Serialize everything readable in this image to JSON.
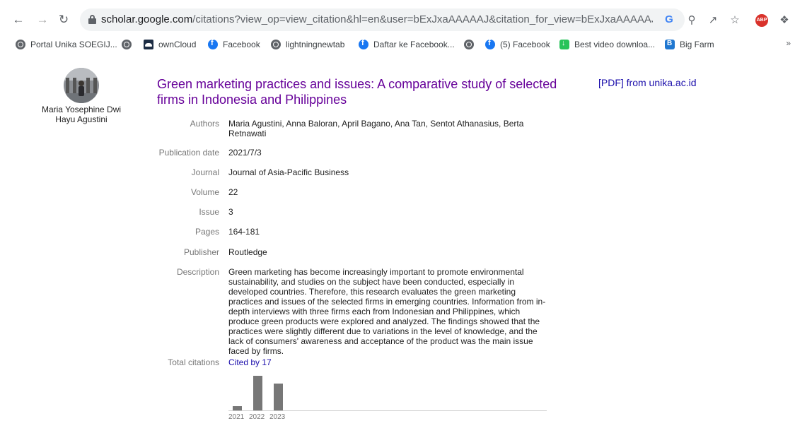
{
  "browser": {
    "url_host": "scholar.google.com",
    "url_rest": "/citations?view_op=view_citation&hl=en&user=bExJxaAAAAAJ&citation_for_view=bExJxaAAAAAJ:aqlVkmm...",
    "extension_abp": "ABP",
    "bookmarks": [
      {
        "label": "Portal Unika SOEGIJ...",
        "icon": "globe-icon"
      },
      {
        "label": "",
        "icon": "globe-icon"
      },
      {
        "label": "ownCloud",
        "icon": "owncloud-icon"
      },
      {
        "label": "Facebook",
        "icon": "facebook-icon"
      },
      {
        "label": "lightningnewtab",
        "icon": "globe-icon"
      },
      {
        "label": "Daftar ke Facebook...",
        "icon": "facebook-icon"
      },
      {
        "label": "",
        "icon": "globe-icon"
      },
      {
        "label": "(5) Facebook",
        "icon": "facebook-icon"
      },
      {
        "label": "Best video downloa...",
        "icon": "download-icon"
      },
      {
        "label": "Big Farm",
        "icon": "bigfarm-icon"
      }
    ],
    "more": "»"
  },
  "profile": {
    "name": "Maria Yosephine Dwi Hayu Agustini"
  },
  "article": {
    "title": "Green marketing practices and issues: A comparative study of selected firms in Indonesia and Philippines",
    "pdf_link": "[PDF] from unika.ac.id",
    "fields": {
      "authors_label": "Authors",
      "authors": "Maria Agustini, Anna Baloran, April Bagano, Ana Tan, Sentot Athanasius, Berta Retnawati",
      "pubdate_label": "Publication date",
      "pubdate": "2021/7/3",
      "journal_label": "Journal",
      "journal": "Journal of Asia-Pacific Business",
      "volume_label": "Volume",
      "volume": "22",
      "issue_label": "Issue",
      "issue": "3",
      "pages_label": "Pages",
      "pages": "164-181",
      "publisher_label": "Publisher",
      "publisher": "Routledge",
      "description_label": "Description",
      "description": "Green marketing has become increasingly important to promote environmental sustainability, and studies on the subject have been conducted, especially in developed countries. Therefore, this research evaluates the green marketing practices and issues of the selected firms in emerging countries. Information from in-depth interviews with three firms each from Indonesian and Philippines, which produce green products were explored and analyzed. The findings showed that the practices were slightly different due to variations in the level of knowledge, and the lack of consumers' awareness and acceptance of the product was the main issue faced by firms.",
      "citations_label": "Total citations",
      "citations": "Cited by 17"
    }
  },
  "chart_data": {
    "type": "bar",
    "categories": [
      "2021",
      "2022",
      "2023"
    ],
    "values": [
      1,
      8,
      6.2
    ],
    "ylim": [
      0,
      8
    ]
  }
}
